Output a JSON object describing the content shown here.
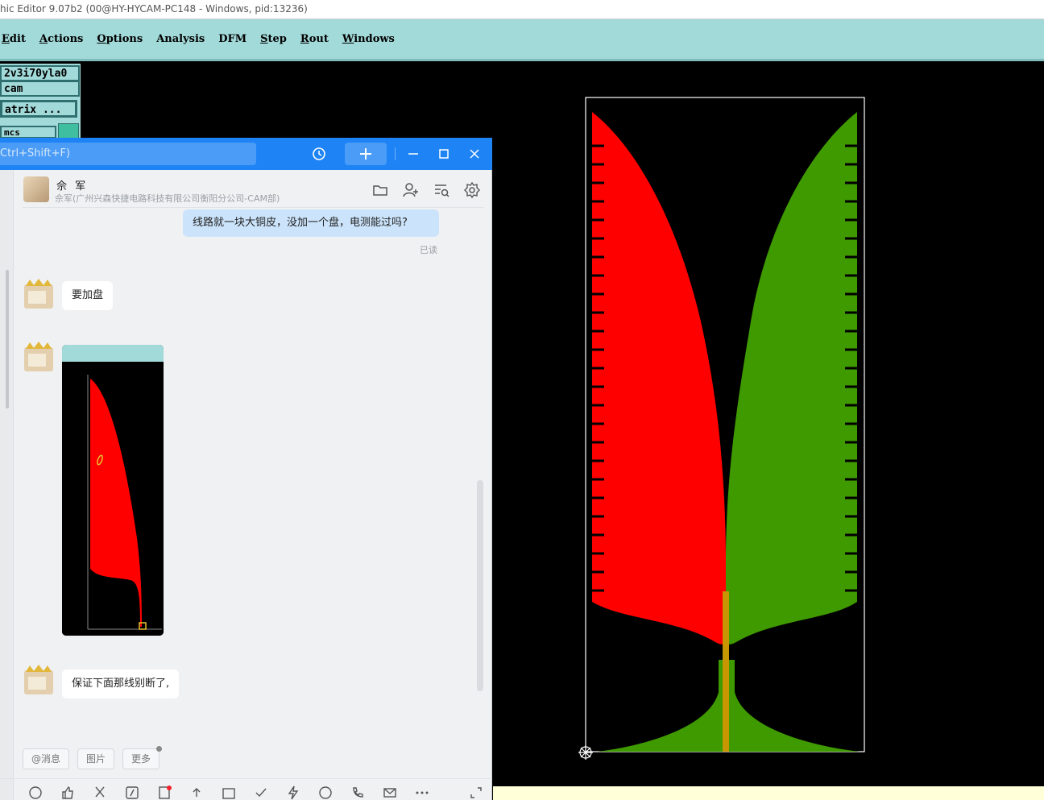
{
  "genesis": {
    "title": "hic Editor 9.07b2 (00@HY-HYCAM-PC148 - Windows, pid:13236)",
    "menu": [
      {
        "label": "Edit",
        "ul": "E"
      },
      {
        "label": "Actions",
        "ul": "A"
      },
      {
        "label": "Options",
        "ul": "O"
      },
      {
        "label": "Analysis",
        "ul": ""
      },
      {
        "label": "DFM",
        "ul": ""
      },
      {
        "label": "Step",
        "ul": "S"
      },
      {
        "label": "Rout",
        "ul": "R"
      },
      {
        "label": "Windows",
        "ul": "W"
      }
    ],
    "job_name": "2v3i70yla0",
    "step_name": "cam",
    "matrix_button": "atrix ...",
    "layer_field": "mcs"
  },
  "chat": {
    "search_placeholder": "Ctrl+Shift+F)",
    "contact": {
      "name": "佘 军",
      "subtitle": "佘军(广州兴森快捷电路科技有限公司衡阳分公司-CAM部)"
    },
    "messages": {
      "outgoing_text": "线路就一块大铜皮，没加一个盘，电测能过吗?",
      "read_status": "已读",
      "reply_1": "要加盘",
      "reply_2": "保证下面那线别断了,"
    },
    "quick_actions": [
      "@消息",
      "图片",
      "更多"
    ]
  },
  "colors": {
    "menu_bg": "#a2d9d9",
    "chat_blue": "#1e84f5",
    "red_layer": "#ff0000",
    "green_layer": "#3f9a00",
    "trace": "#c89600"
  },
  "icons": [
    "history-icon",
    "plus-icon",
    "minimize-icon",
    "maximize-icon",
    "close-icon",
    "folder-icon",
    "add-member-icon",
    "search-history-icon",
    "settings-icon"
  ]
}
